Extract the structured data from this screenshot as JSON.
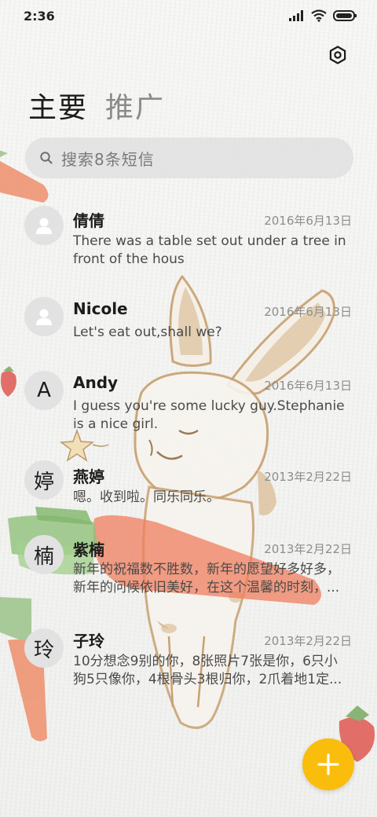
{
  "status_bar": {
    "time": "2:36",
    "icons": [
      "signal-icon",
      "wifi-icon",
      "battery-icon"
    ]
  },
  "header": {
    "settings_icon": "gear-icon",
    "tabs": [
      {
        "label": "主要",
        "active": true
      },
      {
        "label": "推广",
        "active": false
      }
    ]
  },
  "search": {
    "icon": "search-icon",
    "placeholder": "搜索8条短信"
  },
  "conversations": [
    {
      "avatar": "",
      "avatar_icon": "person-icon",
      "name": "倩倩",
      "date": "2016年6月13日",
      "preview": "There was a table set out under a tree in front of the hous"
    },
    {
      "avatar": "",
      "avatar_icon": "person-icon",
      "name": "Nicole",
      "date": "2016年6月13日",
      "preview": "Let's eat out,shall we?"
    },
    {
      "avatar": "A",
      "name": "Andy",
      "date": "2016年6月13日",
      "preview": "I guess you're some lucky guy.Stephanie is a nice girl."
    },
    {
      "avatar": "婷",
      "name": "燕婷",
      "date": "2013年2月22日",
      "preview": "嗯。收到啦。同乐同乐。"
    },
    {
      "avatar": "楠",
      "name": "紫楠",
      "date": "2013年2月22日",
      "preview": "新年的祝福数不胜数，新年的愿望好多好多，新年的问候依旧美好，在这个温馨的时刻，..."
    },
    {
      "avatar": "玲",
      "name": "子玲",
      "date": "2013年2月22日",
      "preview": "10分想念9别的你，8张照片7张是你，6只小狗5只像你，4根骨头3根归你，2爪着地1定..."
    }
  ],
  "fab": {
    "icon": "plus-icon"
  },
  "colors": {
    "accent": "#fbbd0c",
    "avatar_bg": "#e2e2e2",
    "date": "#8d8d8d"
  }
}
